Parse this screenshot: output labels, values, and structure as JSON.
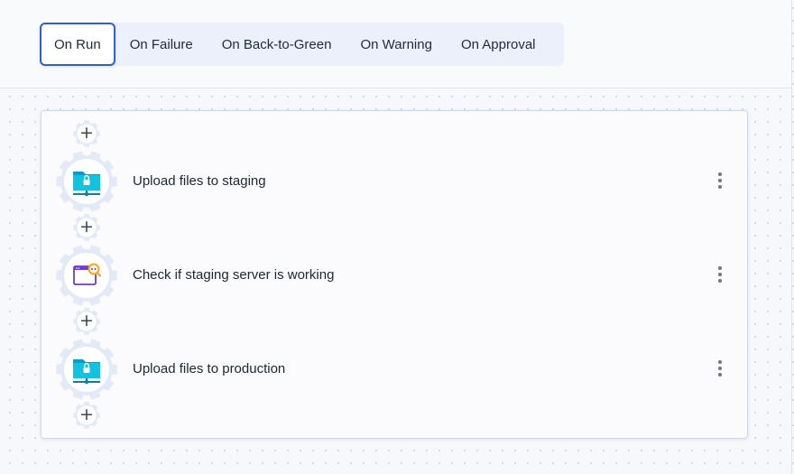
{
  "tabs": [
    {
      "label": "On Run",
      "active": true
    },
    {
      "label": "On Failure",
      "active": false
    },
    {
      "label": "On Back-to-Green",
      "active": false
    },
    {
      "label": "On Warning",
      "active": false
    },
    {
      "label": "On Approval",
      "active": false
    }
  ],
  "steps": [
    {
      "label": "Upload files to staging",
      "icon": "upload-folder-lock-icon"
    },
    {
      "label": "Check if staging server is working",
      "icon": "browser-search-icon"
    },
    {
      "label": "Upload files to production",
      "icon": "upload-folder-lock-icon"
    }
  ],
  "add_step": {
    "glyph": "+"
  },
  "colors": {
    "accent": "#2e62c9",
    "gear": "#e2e9f7",
    "folder_teal": "#0bb8d6",
    "browser_purple": "#6b3fc8",
    "search_orange": "#f3a81b"
  }
}
